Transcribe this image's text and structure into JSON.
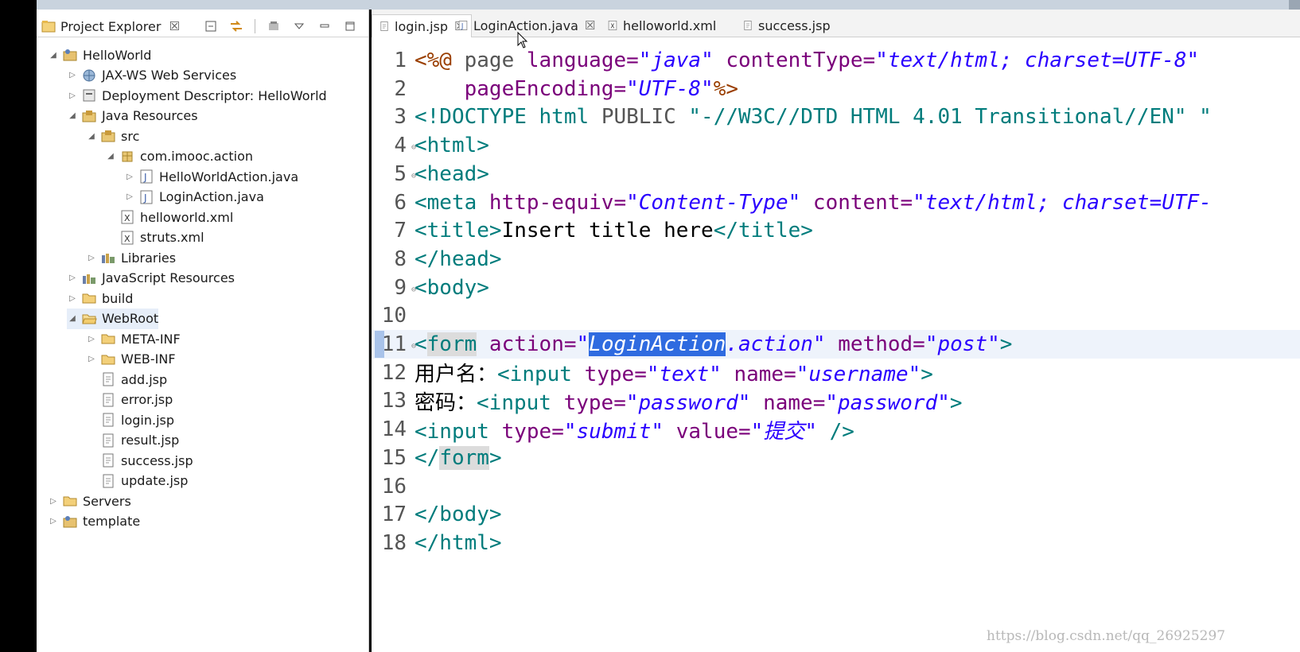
{
  "explorer": {
    "title": "Project Explorer",
    "close": "☒",
    "tree": [
      {
        "label": "HelloWorld",
        "indent": 0,
        "arrow": "◢",
        "icon": "project"
      },
      {
        "label": "JAX-WS Web Services",
        "indent": 1,
        "arrow": "▷",
        "icon": "webservice"
      },
      {
        "label": "Deployment Descriptor: HelloWorld",
        "indent": 1,
        "arrow": "▷",
        "icon": "descriptor"
      },
      {
        "label": "Java Resources",
        "indent": 1,
        "arrow": "◢",
        "icon": "package-folder"
      },
      {
        "label": "src",
        "indent": 2,
        "arrow": "◢",
        "icon": "package-folder"
      },
      {
        "label": "com.imooc.action",
        "indent": 3,
        "arrow": "◢",
        "icon": "package"
      },
      {
        "label": "HelloWorldAction.java",
        "indent": 4,
        "arrow": "▷",
        "icon": "java-file"
      },
      {
        "label": "LoginAction.java",
        "indent": 4,
        "arrow": "▷",
        "icon": "java-file"
      },
      {
        "label": "helloworld.xml",
        "indent": 3,
        "arrow": "",
        "icon": "xml-file"
      },
      {
        "label": "struts.xml",
        "indent": 3,
        "arrow": "",
        "icon": "xml-file"
      },
      {
        "label": "Libraries",
        "indent": 2,
        "arrow": "▷",
        "icon": "library"
      },
      {
        "label": "JavaScript Resources",
        "indent": 1,
        "arrow": "▷",
        "icon": "library"
      },
      {
        "label": "build",
        "indent": 1,
        "arrow": "▷",
        "icon": "folder"
      },
      {
        "label": "WebRoot",
        "indent": 1,
        "arrow": "◢",
        "icon": "folder-open",
        "selected": true
      },
      {
        "label": "META-INF",
        "indent": 2,
        "arrow": "▷",
        "icon": "folder"
      },
      {
        "label": "WEB-INF",
        "indent": 2,
        "arrow": "▷",
        "icon": "folder"
      },
      {
        "label": "add.jsp",
        "indent": 2,
        "arrow": "",
        "icon": "jsp-file"
      },
      {
        "label": "error.jsp",
        "indent": 2,
        "arrow": "",
        "icon": "jsp-file"
      },
      {
        "label": "login.jsp",
        "indent": 2,
        "arrow": "",
        "icon": "jsp-file"
      },
      {
        "label": "result.jsp",
        "indent": 2,
        "arrow": "",
        "icon": "jsp-file"
      },
      {
        "label": "success.jsp",
        "indent": 2,
        "arrow": "",
        "icon": "jsp-file"
      },
      {
        "label": "update.jsp",
        "indent": 2,
        "arrow": "",
        "icon": "jsp-file"
      },
      {
        "label": "Servers",
        "indent": 0,
        "arrow": "▷",
        "icon": "folder"
      },
      {
        "label": "template",
        "indent": 0,
        "arrow": "▷",
        "icon": "project"
      }
    ]
  },
  "editor": {
    "tabs": [
      {
        "label": "login.jsp",
        "close": "☒",
        "active": true,
        "icon": "jsp-file"
      },
      {
        "label": "LoginAction.java",
        "close": "☒",
        "active": false,
        "icon": "java-file"
      },
      {
        "label": "helloworld.xml",
        "close": "",
        "active": false,
        "icon": "xml-file"
      },
      {
        "label": "success.jsp",
        "close": "",
        "active": false,
        "icon": "jsp-file"
      }
    ],
    "lines": [
      {
        "n": "1",
        "fold": false,
        "tokens": [
          [
            "dr",
            "<%@ "
          ],
          [
            "kw",
            "page "
          ],
          [
            "at",
            "language="
          ],
          [
            "st",
            "\"java\""
          ],
          [
            "at",
            " contentType="
          ],
          [
            "st",
            "\"text/html; charset=UTF-8\""
          ]
        ]
      },
      {
        "n": "2",
        "fold": false,
        "tokens": [
          [
            "at",
            "    pageEncoding="
          ],
          [
            "st",
            "\"UTF-8\""
          ],
          [
            "dr",
            "%>"
          ]
        ]
      },
      {
        "n": "3",
        "fold": false,
        "tokens": [
          [
            "tg",
            "<!DOCTYPE html "
          ],
          [
            "kw",
            "PUBLIC "
          ],
          [
            "tg",
            "\"-//W3C//DTD HTML 4.01 Transitional//EN\" \""
          ]
        ]
      },
      {
        "n": "4",
        "fold": true,
        "tokens": [
          [
            "tg",
            "<html>"
          ]
        ]
      },
      {
        "n": "5",
        "fold": true,
        "tokens": [
          [
            "tg",
            "<head>"
          ]
        ]
      },
      {
        "n": "6",
        "fold": false,
        "tokens": [
          [
            "tg",
            "<meta "
          ],
          [
            "at",
            "http-equiv="
          ],
          [
            "st",
            "\"Content-Type\""
          ],
          [
            "at",
            " content="
          ],
          [
            "st",
            "\"text/html; charset=UTF-"
          ]
        ]
      },
      {
        "n": "7",
        "fold": false,
        "tokens": [
          [
            "tg",
            "<title>"
          ],
          [
            "txt",
            "Insert title here"
          ],
          [
            "tg",
            "</title>"
          ]
        ]
      },
      {
        "n": "8",
        "fold": false,
        "tokens": [
          [
            "tg",
            "</head>"
          ]
        ]
      },
      {
        "n": "9",
        "fold": true,
        "tokens": [
          [
            "tg",
            "<body>"
          ]
        ]
      },
      {
        "n": "10",
        "fold": false,
        "tokens": []
      },
      {
        "n": "11",
        "fold": true,
        "current": true,
        "tokens": [
          [
            "tg",
            "<"
          ],
          [
            "tgm",
            "form"
          ],
          [
            "at",
            " action="
          ],
          [
            "st",
            "\""
          ],
          [
            "hl",
            "LoginAction"
          ],
          [
            "st",
            ".action\""
          ],
          [
            "at",
            " method="
          ],
          [
            "st",
            "\"post\""
          ],
          [
            "tg",
            ">"
          ]
        ]
      },
      {
        "n": "12",
        "fold": false,
        "tokens": [
          [
            "txt",
            "用户名："
          ],
          [
            "tg",
            "<input "
          ],
          [
            "at",
            "type="
          ],
          [
            "st",
            "\"text\""
          ],
          [
            "at",
            " name="
          ],
          [
            "st",
            "\"username\""
          ],
          [
            "tg",
            ">"
          ]
        ]
      },
      {
        "n": "13",
        "fold": false,
        "tokens": [
          [
            "txt",
            "密码："
          ],
          [
            "tg",
            "<input "
          ],
          [
            "at",
            "type="
          ],
          [
            "st",
            "\"password\""
          ],
          [
            "at",
            " name="
          ],
          [
            "st",
            "\"password\""
          ],
          [
            "tg",
            ">"
          ]
        ]
      },
      {
        "n": "14",
        "fold": false,
        "tokens": [
          [
            "tg",
            "<input "
          ],
          [
            "at",
            "type="
          ],
          [
            "st",
            "\"submit\""
          ],
          [
            "at",
            " value="
          ],
          [
            "st",
            "\"提交\""
          ],
          [
            "tg",
            " />"
          ]
        ]
      },
      {
        "n": "15",
        "fold": false,
        "tokens": [
          [
            "tg",
            "</"
          ],
          [
            "tgm",
            "form"
          ],
          [
            "tg",
            ">"
          ]
        ]
      },
      {
        "n": "16",
        "fold": false,
        "tokens": []
      },
      {
        "n": "17",
        "fold": false,
        "tokens": [
          [
            "tg",
            "</body>"
          ]
        ]
      },
      {
        "n": "18",
        "fold": false,
        "tokens": [
          [
            "tg",
            "</html>"
          ]
        ]
      }
    ]
  },
  "watermark": "https://blog.csdn.net/qq_26925297"
}
